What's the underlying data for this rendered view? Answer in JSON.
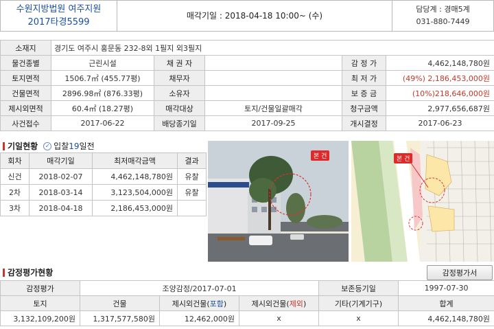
{
  "header": {
    "court": "수원지방법원 여주지원",
    "case_no": "2017타경5599",
    "sale_date": "매각기일 : 2018-04-18   10:00~ (수)",
    "dept": "담당계 : 경매5계",
    "phone": "031-880-7449"
  },
  "info": {
    "address_label": "소재지",
    "address_main": "경기도 여주시 홍문동 232-8외 1필지",
    "address_extra": " 외3필지",
    "rows": [
      {
        "l1": "물건종별",
        "v1": "근린시설",
        "l2": "채 권 자",
        "v2": "",
        "l3": "감 정 가",
        "v3": "4,462,148,780원"
      },
      {
        "l1": "토지면적",
        "v1": "1506.7㎡ (455.77평)",
        "l2": "채무자",
        "v2": "",
        "l3": "최 저 가",
        "v3": "(49%) 2,186,453,000원"
      },
      {
        "l1": "건물면적",
        "v1": "2896.98㎡ (876.33평)",
        "l2": "소유자",
        "v2": "",
        "l3": "보 증 금",
        "v3": "(10%)218,646,000원"
      },
      {
        "l1": "제시외면적",
        "v1": "60.4㎡ (18.27평)",
        "l2": "매각대상",
        "v2": "토지/건물일괄매각",
        "l3": "청구금액",
        "v3": "2,977,656,687원"
      },
      {
        "l1": "사건접수",
        "v1": "2017-06-22",
        "l2": "배당종기일",
        "v2": "2017-09-25",
        "l3": "개시결정",
        "v3": "2017-06-23"
      }
    ]
  },
  "history": {
    "title": "기일현황",
    "bid_prefix": "입찰",
    "bid_days": "19",
    "bid_suffix": "일전",
    "headers": [
      "회차",
      "매각기일",
      "최저매각금액",
      "결과"
    ],
    "rows": [
      {
        "round": "신건",
        "date": "2018-02-07",
        "price": "4,462,148,780원",
        "result": "유찰"
      },
      {
        "round": "2차",
        "date": "2018-03-14",
        "price": "3,123,504,000원",
        "result": "유찰"
      },
      {
        "round": "3차",
        "date": "2018-04-18",
        "price": "2,186,453,000원",
        "result": ""
      }
    ]
  },
  "photos": {
    "photo_tag": "본 건",
    "map_tag": "본 건"
  },
  "appraisal": {
    "title": "감정평가현황",
    "button": "감정평가서",
    "r1": {
      "l1": "감정평가",
      "v1": "조양감정/2017-07-01",
      "l2": "보존등기일",
      "v2": "1997-07-30"
    },
    "headers": {
      "land": "토지",
      "bldg": "건물",
      "incl_pre": "제시외건물(",
      "incl_kw": "포함",
      "excl_pre": "제시외건물(",
      "excl_kw": "제외",
      "paren_close": ")",
      "etc": "기타(기계기구)",
      "total": "합계"
    },
    "values": {
      "land": "3,132,109,200원",
      "bldg": "1,317,577,580원",
      "incl": "12,462,000원",
      "excl": "x",
      "etc": "x",
      "total": "4,462,148,780원"
    }
  }
}
